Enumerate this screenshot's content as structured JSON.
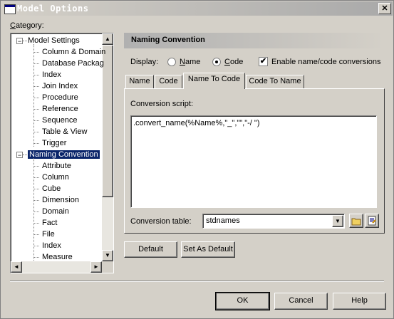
{
  "window": {
    "title": "Model Options",
    "close": "✕"
  },
  "category_label": "Category:",
  "tree": {
    "groups": [
      {
        "label": "Model Settings",
        "expander": "−",
        "children": [
          "Column & Domain",
          "Database Packag",
          "Index",
          "Join Index",
          "Procedure",
          "Reference",
          "Sequence",
          "Table & View",
          "Trigger"
        ]
      },
      {
        "label": "Naming Convention",
        "expander": "−",
        "selected": true,
        "children": [
          "Attribute",
          "Column",
          "Cube",
          "Dimension",
          "Domain",
          "Fact",
          "File",
          "Index",
          "Measure"
        ]
      }
    ]
  },
  "scroll": {
    "up": "▲",
    "down": "▼",
    "left": "◄",
    "right": "►"
  },
  "section": {
    "title": "Naming Convention",
    "display_label": "Display:",
    "display_options": [
      {
        "label": "Name",
        "selected": false
      },
      {
        "label": "Code",
        "selected": true
      }
    ],
    "enable_conversions": {
      "label": "Enable name/code conversions",
      "checked": true,
      "mark": "✔"
    },
    "tabs": [
      {
        "label": "Name",
        "active": false
      },
      {
        "label": "Code",
        "active": false
      },
      {
        "label": "Name To Code",
        "active": true
      },
      {
        "label": "Code To Name",
        "active": false
      }
    ],
    "script_label": "Conversion script:",
    "script_value": ".convert_name(%Name%,\"_\",\"\",\"-/ \")",
    "table_label": "Conversion table:",
    "table_value": "stdnames",
    "table_arrow": "▼"
  },
  "buttons": {
    "default": "Default",
    "set_as_default": "Set As Default",
    "ok": "OK",
    "cancel": "Cancel",
    "help": "Help"
  }
}
